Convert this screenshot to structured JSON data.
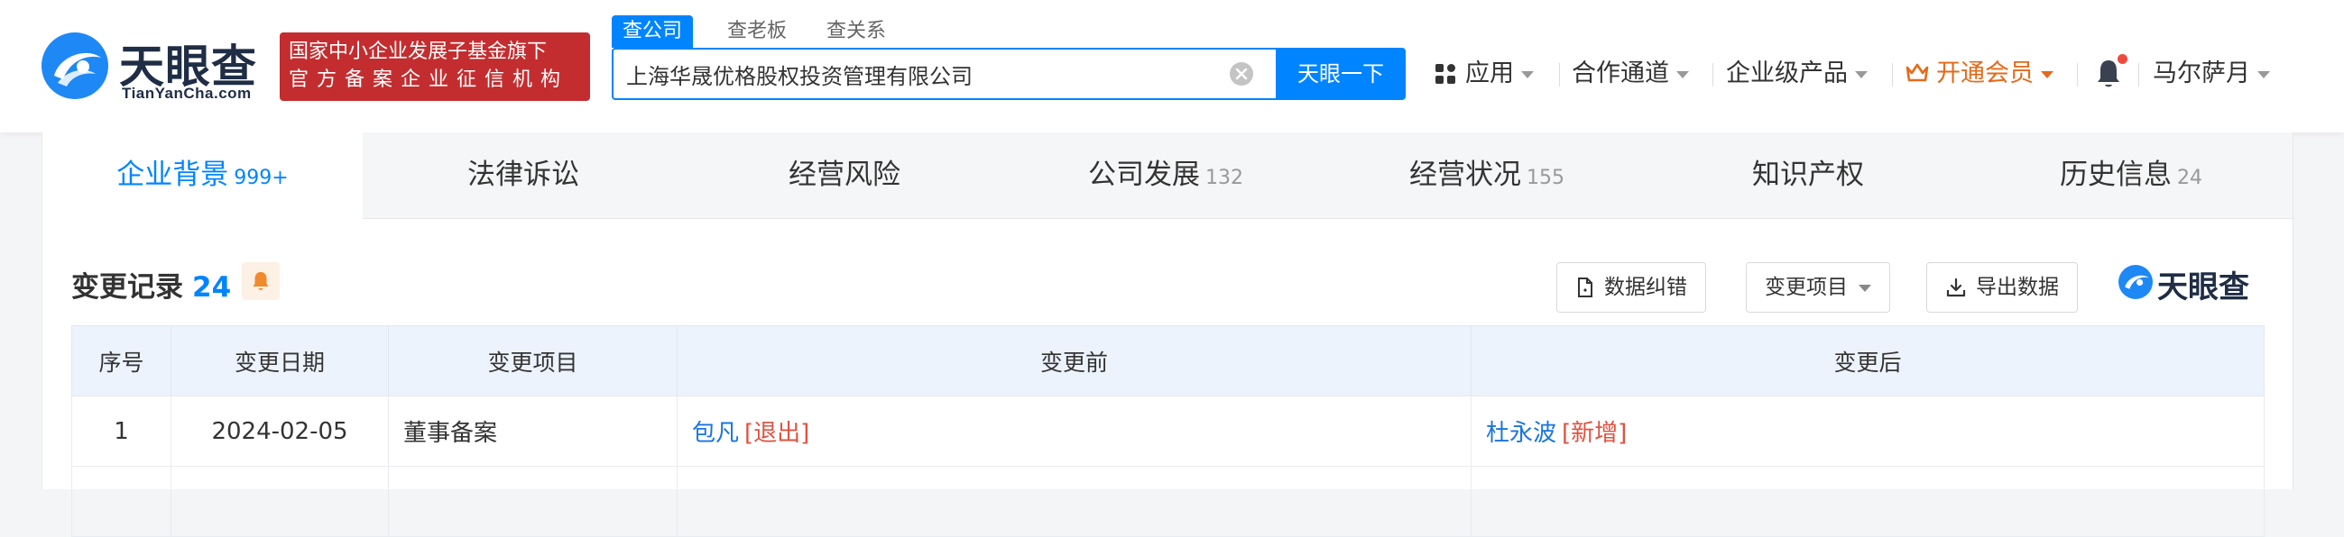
{
  "header": {
    "logo_cn": "天眼查",
    "logo_en": "TianYanCha.com",
    "gov_badge_line1": "国家中小企业发展子基金旗下",
    "gov_badge_line2": "官方备案企业征信机构",
    "search_tabs": [
      "查公司",
      "查老板",
      "查关系"
    ],
    "search_value": "上海华晟优格股权投资管理有限公司",
    "search_button": "天眼一下",
    "nav": {
      "apps": "应用",
      "partner": "合作通道",
      "enterprise": "企业级产品",
      "vip": "开通会员",
      "user": "马尔萨月"
    }
  },
  "tabs": [
    {
      "label": "企业背景",
      "count": "999+"
    },
    {
      "label": "法律诉讼",
      "count": ""
    },
    {
      "label": "经营风险",
      "count": ""
    },
    {
      "label": "公司发展",
      "count": "132"
    },
    {
      "label": "经营状况",
      "count": "155"
    },
    {
      "label": "知识产权",
      "count": ""
    },
    {
      "label": "历史信息",
      "count": "24"
    }
  ],
  "section": {
    "title": "变更记录",
    "count": "24",
    "btn_correct": "数据纠错",
    "btn_filter": "变更项目",
    "btn_export": "导出数据",
    "watermark": "天眼查"
  },
  "table": {
    "headers": [
      "序号",
      "变更日期",
      "变更项目",
      "变更前",
      "变更后"
    ],
    "rows": [
      {
        "index": "1",
        "date": "2024-02-05",
        "item": "董事备案",
        "before_name": "包凡",
        "before_tag": "[退出]",
        "after_name": "杜永波",
        "after_tag": "[新增]"
      }
    ]
  },
  "colors": {
    "brand_blue": "#0084ff",
    "gov_red": "#c42d2f",
    "vip_orange": "#e56a1a",
    "tag_red": "#e0513f",
    "person_blue": "#1a74e0"
  }
}
